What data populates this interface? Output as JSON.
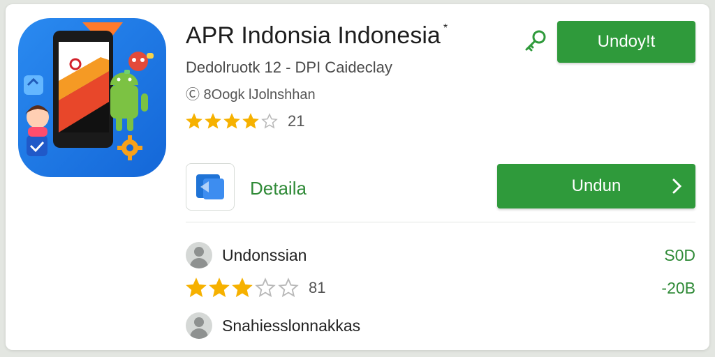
{
  "app": {
    "title": "APR Indonsia Indonesia",
    "title_mark": "*",
    "subtitle": "Dedolruotk 12 - DPI Caideclay",
    "meta": "Ⓒ 8Oogk lJolnshhan",
    "rating": 4,
    "rating_max": 5,
    "rating_count": "21"
  },
  "buttons": {
    "top_label": "Undoy!t",
    "main_label": "Undun"
  },
  "details": {
    "label": "Detaila"
  },
  "list": [
    {
      "label": "Undonssian",
      "value": "S0D"
    },
    {
      "rating": 3,
      "rating_max": 5,
      "count": "81",
      "value": "-20B"
    },
    {
      "label": "Snahiesslonnakkas"
    }
  ],
  "colors": {
    "accent_green": "#2f9a3b",
    "star_gold": "#f6b100",
    "star_empty": "#b8b8b8"
  },
  "icons": {
    "app": "phone-android-app-icon",
    "key": "key-icon",
    "detail": "document-icon",
    "chevron": "chevron-right-icon",
    "avatar": "user-avatar-icon"
  }
}
